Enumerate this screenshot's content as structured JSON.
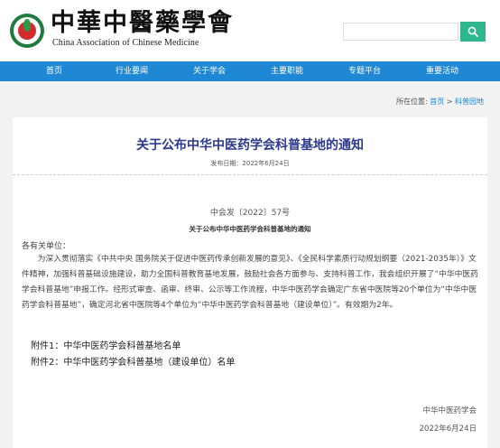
{
  "header": {
    "logo_cn": "中華中醫藥學會",
    "logo_en": "China Association of Chinese Medicine",
    "search": {
      "placeholder": "",
      "value": "",
      "icon": "search-icon"
    }
  },
  "nav": {
    "items": [
      {
        "label": "首页"
      },
      {
        "label": "行业要闻"
      },
      {
        "label": "关于学会"
      },
      {
        "label": "主要职能"
      },
      {
        "label": "专题平台"
      },
      {
        "label": "重要活动"
      }
    ]
  },
  "breadcrumb": {
    "prefix": "所在位置:",
    "home": "首页",
    "separator": ">",
    "current": "科普园地"
  },
  "article": {
    "title": "关于公布中华中医药学会科普基地的通知",
    "date": "发布日期：2022年6月24日",
    "doc_number": "中会发〔2022〕57号",
    "doc_title": "关于公布中华中医药学会科普基地的通知",
    "greeting": "各有关单位：",
    "body": "为深入贯彻落实《中共中央 国务院关于促进中医药传承创新发展的意见》、《全民科学素质行动规划纲要（2021-2035年）》文件精神，加强科普基础设施建设，助力全国科普教育基地发展，鼓励社会各方面参与、支持科普工作，我会组织开展了“中华中医药学会科普基地”申报工作。经形式审查、函审、终审、公示等工作流程，中华中医药学会确定广东省中医院等20个单位为“中华中医药学会科普基地”，确定河北省中医院等4个单位为“中华中医药学会科普基地（建设单位）”。有效期为2年。",
    "attachments": [
      "附件1：中华中医药学会科普基地名单",
      "附件2：中华中医药学会科普基地（建设单位）名单"
    ],
    "sign_org": "中华中医药学会",
    "sign_date": "2022年6月24日"
  },
  "colors": {
    "nav_bg": "#1e88d4",
    "title": "#2d3a8c",
    "search_button": "#2eb68c",
    "link": "#1e88d4"
  }
}
